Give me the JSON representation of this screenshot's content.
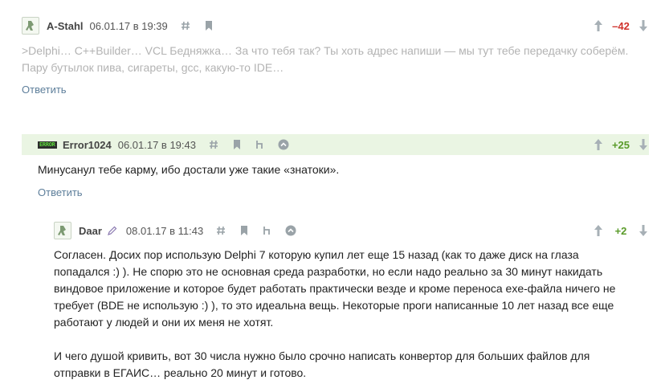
{
  "colors": {
    "negative_score": "#d0322c",
    "positive_score": "#5a9b2a",
    "highlight_bg": "#eaf5e3",
    "reply_link": "#5e7f9b",
    "faded_text": "#b3b3b3"
  },
  "comments": [
    {
      "user": "A-Stahl",
      "date": "06.01.17 в 19:39",
      "score": "–42",
      "text": ">Delphi… C++Builder… VCL Бедняжка… За что тебя так? Ты хоть адрес напиши — мы тут тебе передачку соберём. Пару бутылок пива, сигареты, gcc, какую-то IDE…",
      "reply_label": "Ответить",
      "icons": [
        "hash-icon",
        "bookmark-icon"
      ]
    },
    {
      "user": "Error1024",
      "avatar_badge": "ERROR",
      "date": "06.01.17 в 19:43",
      "score": "+25",
      "text": "Минусанул тебе карму, ибо достали уже такие «знатоки».",
      "reply_label": "Ответить",
      "icons": [
        "hash-icon",
        "bookmark-icon",
        "parent-icon",
        "branch-icon"
      ]
    },
    {
      "user": "Daar",
      "date": "08.01.17 в 11:43",
      "score": "+2",
      "paragraph_1": "Согласен. Досих пор использую Delphi 7 которую купил лет еще 15 назад (как то даже диск на глаза попадался :) ). Не спорю это не основная среда разработки, но если надо реально за 30 минут накидать виндовое приложение и которое будет работать практически везде и кроме переноса exe-файла ничего не требует (BDE не использую :) ), то это идеальна вещь. Некоторые проги написанные 10 лет назад все еще работают у людей и они их меня не хотят.",
      "paragraph_2": "И чего душой кривить, вот 30 числа нужно было срочно написать конвертор для больших файлов для отправки в ЕГАИС… реально 20 минут и готово.",
      "icons": [
        "edit-icon",
        "hash-icon",
        "bookmark-icon",
        "parent-icon",
        "branch-icon"
      ]
    }
  ]
}
